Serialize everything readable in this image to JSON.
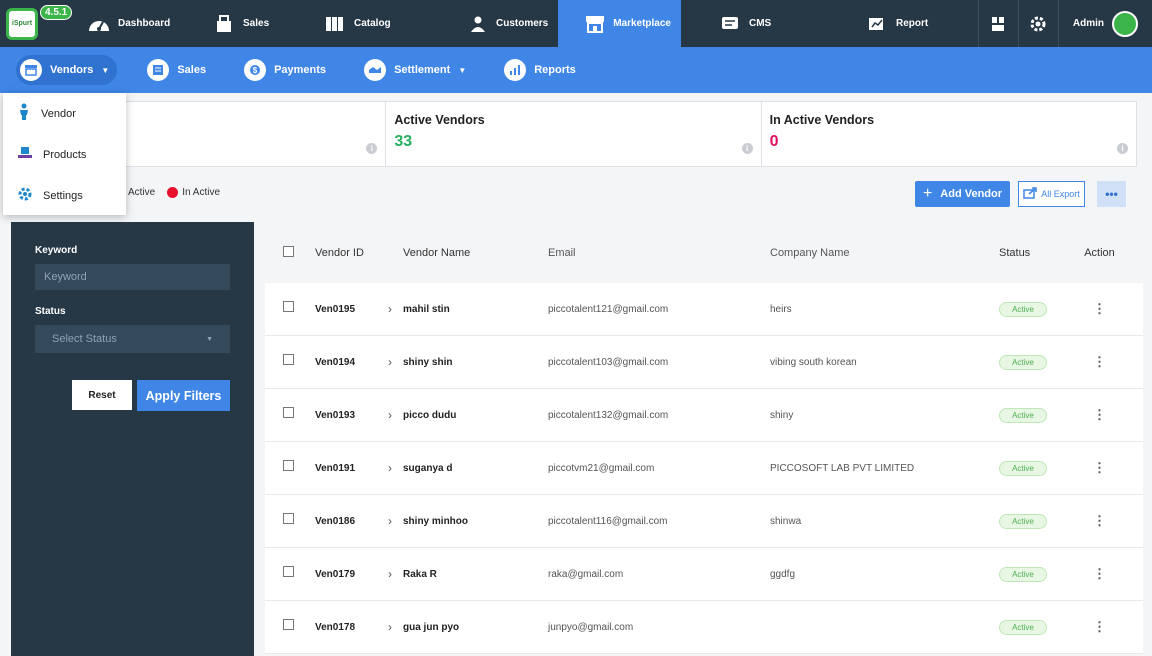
{
  "brand": {
    "logo_text": "iSpurt Marketplace",
    "version": "4.5.1"
  },
  "topnav": [
    {
      "label": "Dashboard",
      "icon": "speedometer-icon"
    },
    {
      "label": "Sales",
      "icon": "cart-icon"
    },
    {
      "label": "Catalog",
      "icon": "book-icon"
    },
    {
      "label": "Customers",
      "icon": "users-icon"
    },
    {
      "label": "Marketplace",
      "icon": "store-icon",
      "active": true
    },
    {
      "label": "CMS",
      "icon": "cms-icon"
    },
    {
      "label": "Report",
      "icon": "report-icon"
    }
  ],
  "topbar_right": {
    "admin_label": "Admin"
  },
  "subnav": {
    "vendors": "Vendors",
    "sales": "Sales",
    "payments": "Payments",
    "settlement": "Settlement",
    "reports": "Reports"
  },
  "dropdown": {
    "vendor": "Vendor",
    "products": "Products",
    "settings": "Settings"
  },
  "cards": [
    {
      "title": "",
      "value": ""
    },
    {
      "title": "Active Vendors",
      "value": "33"
    },
    {
      "title": "In Active Vendors",
      "value": "0"
    }
  ],
  "legend": {
    "active": "Active",
    "inactive": "In Active"
  },
  "actions": {
    "add_vendor": "Add Vendor",
    "export": "All Export",
    "more": "•••"
  },
  "filter": {
    "keyword_label": "Keyword",
    "keyword_placeholder": "Keyword",
    "status_label": "Status",
    "status_placeholder": "Select Status",
    "reset": "Reset",
    "apply": "Apply Filters"
  },
  "table": {
    "headers": {
      "vendor_id": "Vendor ID",
      "vendor_name": "Vendor Name",
      "email": "Email",
      "company": "Company Name",
      "status": "Status",
      "action": "Action"
    },
    "rows": [
      {
        "id": "Ven0195",
        "name": "mahil stin",
        "email": "piccotalent121@gmail.com",
        "company": "heirs",
        "status": "Active"
      },
      {
        "id": "Ven0194",
        "name": "shiny shin",
        "email": "piccotalent103@gmail.com",
        "company": "vibing south korean",
        "status": "Active"
      },
      {
        "id": "Ven0193",
        "name": "picco dudu",
        "email": "piccotalent132@gmail.com",
        "company": "shiny",
        "status": "Active"
      },
      {
        "id": "Ven0191",
        "name": "suganya d",
        "email": "piccotvm21@gmail.com",
        "company": "PICCOSOFT LAB PVT LIMITED",
        "status": "Active"
      },
      {
        "id": "Ven0186",
        "name": "shiny minhoo",
        "email": "piccotalent116@gmail.com",
        "company": "shinwa",
        "status": "Active"
      },
      {
        "id": "Ven0179",
        "name": "Raka R",
        "email": "raka@gmail.com",
        "company": "ggdfg",
        "status": "Active"
      },
      {
        "id": "Ven0178",
        "name": "gua jun pyo",
        "email": "junpyo@gmail.com",
        "company": "",
        "status": "Active"
      }
    ]
  },
  "colors": {
    "nav_dark": "#263846",
    "accent_blue": "#3f86e6",
    "active_green": "#3bb54a",
    "inactive_red": "#e8112d",
    "value_green": "#27ae60",
    "value_pink": "#e0115f"
  }
}
